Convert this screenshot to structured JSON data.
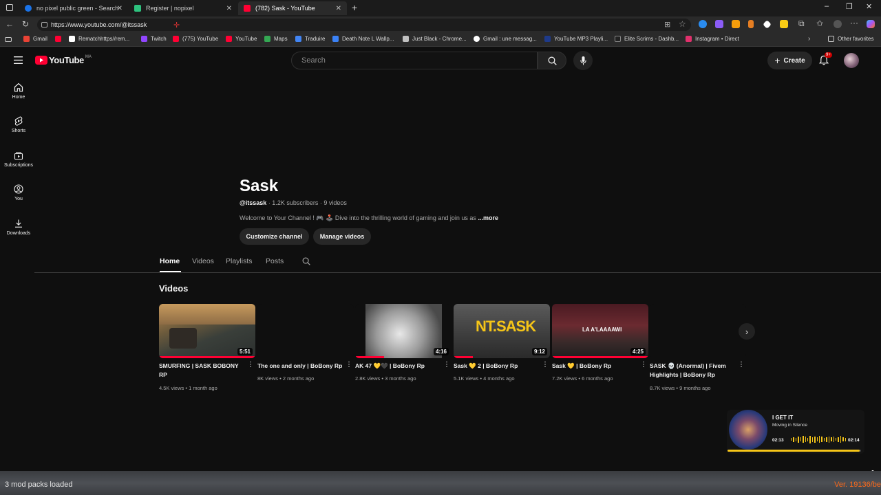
{
  "browser": {
    "tabs": [
      {
        "title": "no pixel public green - Search",
        "icon_color": "#1a73e8",
        "active": false
      },
      {
        "title": "Register | nopixel",
        "icon_color": "#2ec27e",
        "active": false
      },
      {
        "title": "(782) Sask - YouTube",
        "icon_color": "#ff0033",
        "active": true
      }
    ],
    "new_tab": "+",
    "url": "https://www.youtube.com/@itssask",
    "bookmarks": [
      {
        "label": "Gmail",
        "icon_color": "#ea4335"
      },
      {
        "label": "",
        "icon_color": "#ff0033"
      },
      {
        "label": "Rematchhttps//rem...",
        "icon_color": "#ffffff"
      },
      {
        "label": "Twitch",
        "icon_color": "#9146ff"
      },
      {
        "label": "(775) YouTube",
        "icon_color": "#ff0033"
      },
      {
        "label": "YouTube",
        "icon_color": "#ff0033"
      },
      {
        "label": "Maps",
        "icon_color": "#34a853"
      },
      {
        "label": "Traduire",
        "icon_color": "#4285f4"
      },
      {
        "label": "Death Note L Wallp...",
        "icon_color": "#3b82f6"
      },
      {
        "label": "Just Black - Chrome...",
        "icon_color": "#c0c0c0"
      },
      {
        "label": "Gmail : une messag...",
        "icon_color": "#ffffff"
      },
      {
        "label": "YouTube MP3 Playli...",
        "icon_color": "#1e3a8a"
      },
      {
        "label": "Elite Scrims - Dashb...",
        "icon_color": "#222222"
      },
      {
        "label": "Instagram • Direct",
        "icon_color": "#e1306c"
      }
    ],
    "other_favorites": "Other favorites"
  },
  "youtube": {
    "logo_text": "YouTube",
    "logo_region": "MA",
    "search_placeholder": "Search",
    "create_label": "Create",
    "notif_badge": "9+",
    "sidebar": [
      {
        "label": "Home",
        "icon": "home-icon"
      },
      {
        "label": "Shorts",
        "icon": "shorts-icon"
      },
      {
        "label": "Subscriptions",
        "icon": "subscriptions-icon"
      },
      {
        "label": "You",
        "icon": "you-icon"
      },
      {
        "label": "Downloads",
        "icon": "downloads-icon"
      }
    ],
    "channel": {
      "name": "Sask",
      "handle": "@itssask",
      "stats": " · 1.2K subscribers · 9 videos",
      "description": "Welcome to Your  Channel ! 🎮 🕹️  Dive into the thrilling world of gaming and join us as",
      "more": "...more",
      "customize_label": "Customize channel",
      "manage_label": "Manage videos"
    },
    "tabs": [
      "Home",
      "Videos",
      "Playlists",
      "Posts"
    ],
    "section_title": "Videos",
    "videos": [
      {
        "title": "SMURFING | SASK BOBONY RP",
        "views": "4.5K views",
        "age": "1 month ago",
        "duration": "5:51",
        "watched": 1.0
      },
      {
        "title": "The one and only | BoBony Rp",
        "views": "8K views",
        "age": "2 months ago",
        "duration": "",
        "watched": 0
      },
      {
        "title": "AK 47 💛🖤 | BoBony Rp",
        "views": "2.8K views",
        "age": "3 months ago",
        "duration": "4:16",
        "watched": 0.3
      },
      {
        "title": "Sask 💛 2 | BoBony Rp",
        "views": "5.1K views",
        "age": "4 months ago",
        "duration": "9:12",
        "watched": 0.2
      },
      {
        "title": "Sask 💛 | BoBony Rp",
        "views": "7.2K views",
        "age": "6 months ago",
        "duration": "4:25",
        "watched": 1.0
      },
      {
        "title": "SASK 💀 (Anormal) | Fivem Highlights | BoBony Rp",
        "views": "8.7K views",
        "age": "9 months ago",
        "duration": "",
        "watched": 0
      }
    ],
    "thumb_texts": {
      "v4": "NT.SASK",
      "v5": "LA A'LAAAAWI"
    }
  },
  "music_widget": {
    "title": "I GET IT",
    "artist": "Moving in Silence",
    "elapsed": "02:13",
    "total": "02:14",
    "progress": 0.99,
    "accent": "#f5c518"
  },
  "overlay": {
    "mods_loaded": "3 mod packs loaded",
    "version": "Ver. 19136/be"
  }
}
